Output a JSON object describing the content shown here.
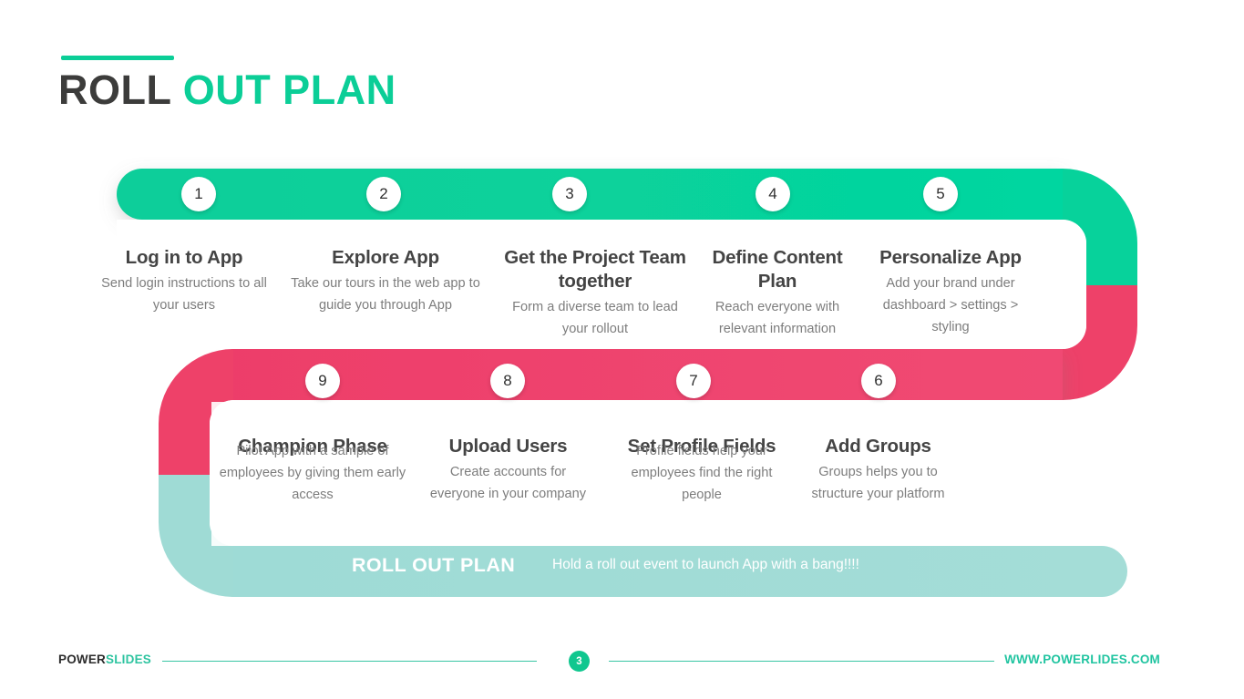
{
  "header": {
    "title_dark": "ROLL",
    "title_accent": "OUT PLAN"
  },
  "colors": {
    "green": "#08D29B",
    "pink": "#EE4169",
    "teal": "#9FDBD5",
    "title_dark": "#3C3C3B",
    "text_title": "#444444",
    "text_body": "#7d7d7d"
  },
  "steps": [
    {
      "number": "1",
      "title": "Log in to App",
      "desc": "Send login instructions to all your users"
    },
    {
      "number": "2",
      "title": "Explore App",
      "desc": "Take our tours in the web app to guide you through App"
    },
    {
      "number": "3",
      "title": "Get the Project Team together",
      "desc": "Form a diverse team to lead your rollout"
    },
    {
      "number": "4",
      "title": "Define Content Plan",
      "desc": "Reach everyone with relevant information"
    },
    {
      "number": "5",
      "title": "Personalize App",
      "desc": "Add your brand under dashboard > settings > styling"
    },
    {
      "number": "9",
      "title": "Champion Phase",
      "desc": "Pilot App with a sample of employees by giving them early access"
    },
    {
      "number": "8",
      "title": "Upload Users",
      "desc": "Create accounts for everyone in your company"
    },
    {
      "number": "7",
      "title": "Set Profile Fields",
      "desc": "Profile fields help your employees find the right people"
    },
    {
      "number": "6",
      "title": "Add Groups",
      "desc": "Groups helps you to structure your platform"
    }
  ],
  "banner": {
    "title": "ROLL OUT PLAN",
    "subtitle": "Hold a roll out event to launch App with a bang!!!!"
  },
  "footer": {
    "logo_dark": "POWER",
    "logo_accent": "SLIDES",
    "page_number": "3",
    "url": "WWW.POWERLIDES.COM"
  }
}
